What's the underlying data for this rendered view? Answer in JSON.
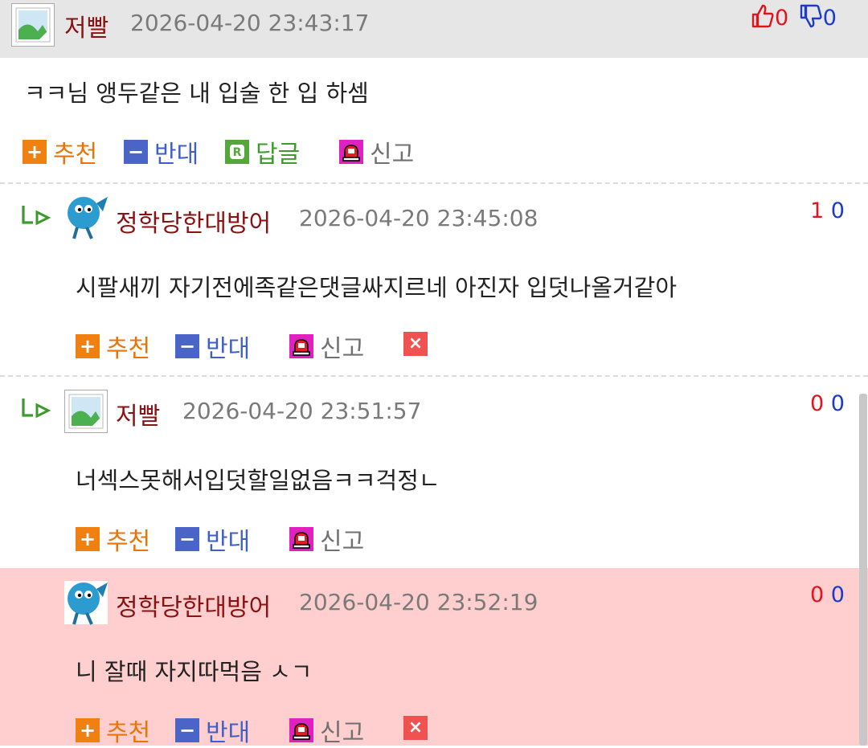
{
  "actions": {
    "recommend": "추천",
    "oppose": "반대",
    "reply": "답글",
    "report": "신고"
  },
  "comments": [
    {
      "nick": "저빨",
      "time": "2026-04-20 23:43:17",
      "text": "ㅋㅋ님 앵두같은 내 입술 한 입 하셈",
      "up": "0",
      "down": "0",
      "avatar_icon": "broken-image-icon"
    },
    {
      "nick": "정학당한대방어",
      "time": "2026-04-20 23:45:08",
      "text": "시팔새끼 자기전에족같은댓글싸지르네 아진자 입덧나올거같아",
      "up": "1",
      "down": "0",
      "avatar_icon": "blue-ball-character-icon"
    },
    {
      "nick": "저빨",
      "time": "2026-04-20 23:51:57",
      "text": "너섹스못해서입덧할일없음ㅋㅋ걱정ㄴ",
      "up": "0",
      "down": "0",
      "avatar_icon": "broken-image-icon"
    },
    {
      "nick": "정학당한대방어",
      "time": "2026-04-20 23:52:19",
      "text": "니 잘때 자지따먹음 ㅅㄱ",
      "up": "0",
      "down": "0",
      "avatar_icon": "blue-ball-character-icon"
    }
  ],
  "colors": {
    "nick": "#8a1212",
    "up_vote": "#e0141e",
    "down_vote": "#1a3cc8",
    "recommend": "#f08010",
    "oppose": "#4a64c8",
    "reply": "#54a83a",
    "report": "#e020c0",
    "delete": "#f05252",
    "highlight_bg": "#ffcfcf",
    "header_bg": "#e6e6e6"
  }
}
